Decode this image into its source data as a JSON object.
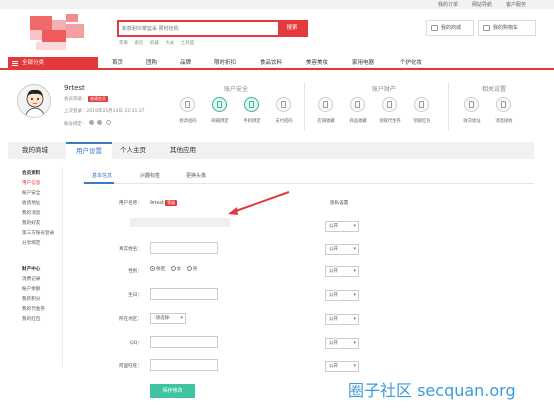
{
  "topbar": {
    "links": [
      "我的订单",
      "网站导航",
      "客户服务"
    ]
  },
  "search": {
    "placeholder": "新款耐伙菜篮采 限时抢购",
    "button_label": "搜索"
  },
  "hot_words": [
    "苹果",
    "索尼",
    "机器",
    "大米",
    "土鸡蛋"
  ],
  "header": {
    "my_mall_label": "我的商城",
    "cart_label": "我的购物车"
  },
  "nav": {
    "all_categories": "全部分类",
    "items": [
      "首页",
      "团购",
      "品牌",
      "限时折扣",
      "食品饮料",
      "美容美妆",
      "家用电器",
      "个护化妆"
    ]
  },
  "user": {
    "name": "9rtest",
    "level_label": "会员等级：",
    "level_badge": "普通会员",
    "last_login": "上次登录：2019年05月14日 22:11:27",
    "bind_label": "账号绑定："
  },
  "sections": [
    {
      "title": "账户安全",
      "items": [
        "修改密码",
        "邮箱绑定",
        "手机绑定",
        "支付密码"
      ]
    },
    {
      "title": "账户财产",
      "items": [
        "店铺收藏",
        "商品收藏",
        "领取代金券",
        "领取红包"
      ]
    },
    {
      "title": "相关设置",
      "items": [
        "收货地址",
        "消息接收"
      ]
    }
  ],
  "tabs": [
    "我的商城",
    "用户设置",
    "个人主页",
    "其他应用"
  ],
  "sidebar": {
    "group1_title": "会员资料",
    "group1_items": [
      "用户信息",
      "账户安全",
      "收货地址",
      "我的消息",
      "我的好友",
      "第三方账号登录",
      "分享绑定"
    ],
    "group2_title": "财产中心",
    "group2_items": [
      "消费记录",
      "账户余额",
      "我的积分",
      "我的代金券",
      "我的红包"
    ]
  },
  "subtabs": [
    "基本信息",
    "兴趣标签",
    "更换头像"
  ],
  "form": {
    "username_label": "用户名称：",
    "username_value": "9rtest",
    "username_badge": "等级",
    "privacy_header": "隐私设置",
    "realname_label": "真实姓名：",
    "gender_label": "性别：",
    "gender_options": [
      "保密",
      "女",
      "男"
    ],
    "birthday_label": "生日：",
    "region_label": "所在地区：",
    "region_select": "-请选择-",
    "qq_label": "QQ：",
    "wangwang_label": "阿里旺旺：",
    "privacy_option": "公开",
    "save_label": "保存修改"
  },
  "watermark": "圈子社区 secquan.org",
  "colors": {
    "accent": "#e4393c",
    "blue": "#3b7bc6",
    "green": "#3ec3a3"
  }
}
